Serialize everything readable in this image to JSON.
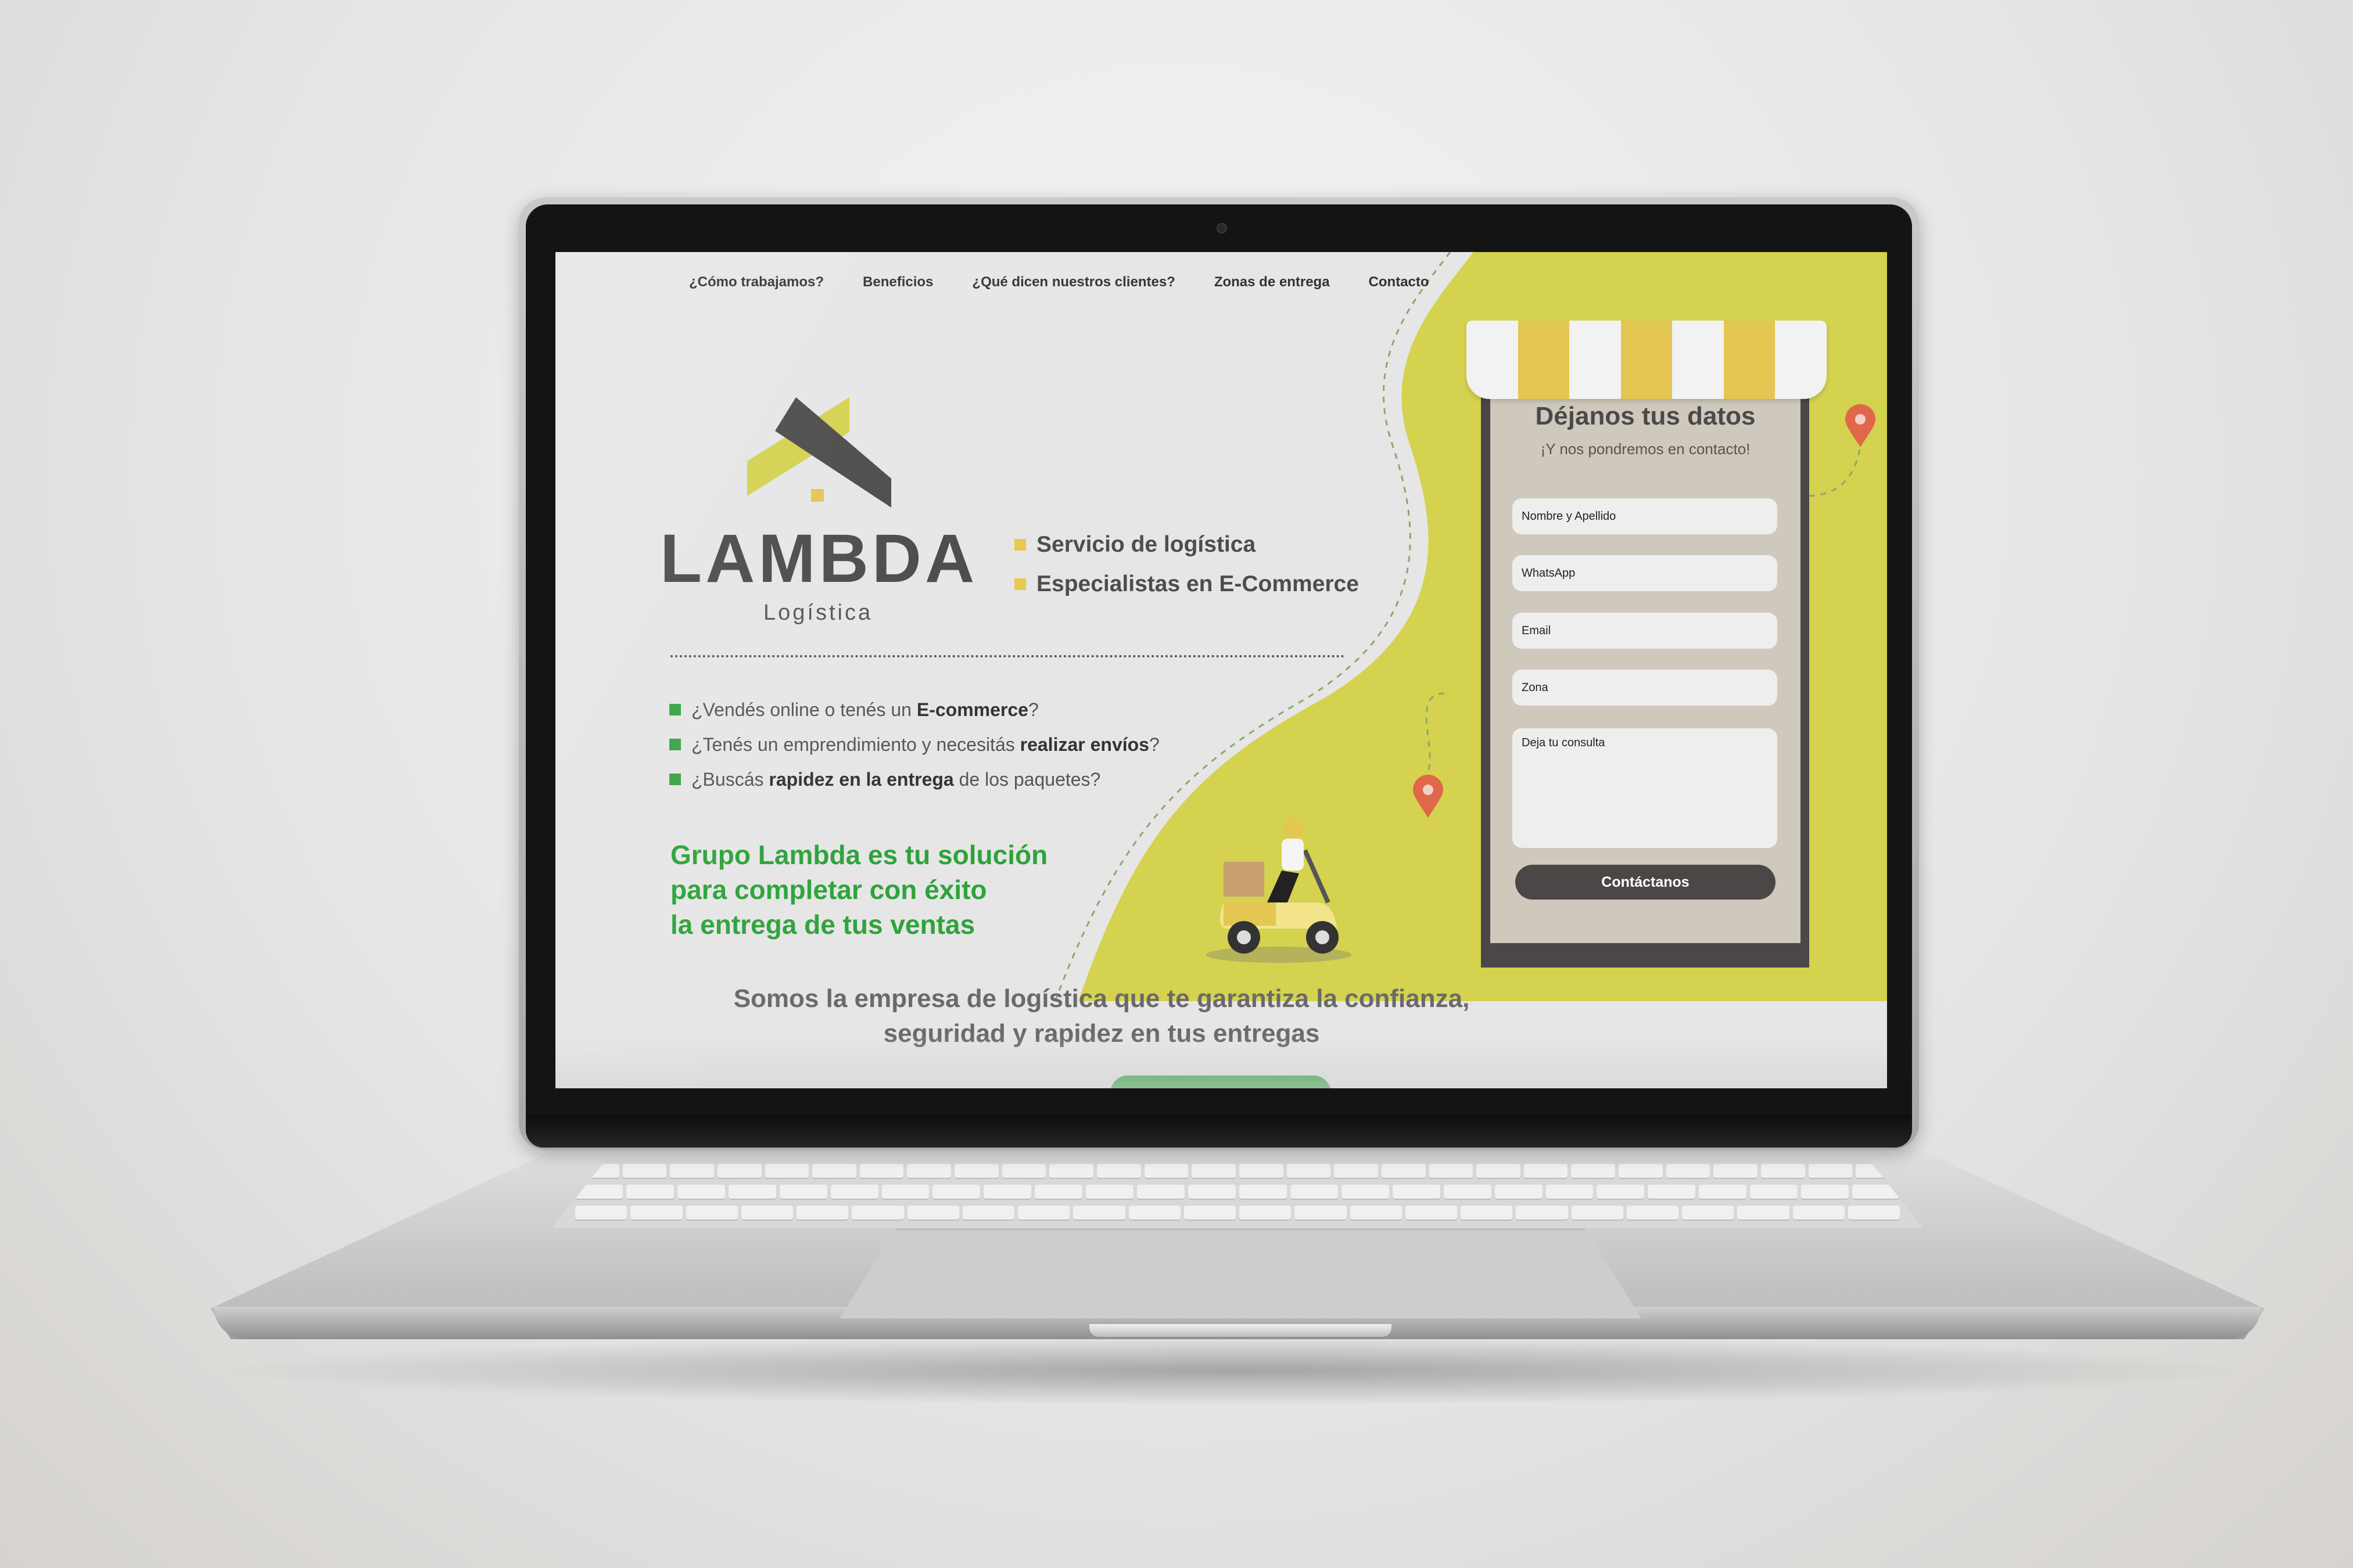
{
  "site": {
    "nav": [
      "¿Cómo trabajamos?",
      "Beneficios",
      "¿Qué dicen nuestros clientes?",
      "Zonas de entrega",
      "Contacto"
    ],
    "logo": {
      "word": "LAMBDA",
      "sub": "Logística"
    },
    "tags": [
      "Servicio de logística",
      "Especialistas en E-Commerce"
    ],
    "questions": [
      {
        "pre": "¿Vendés online o tenés un ",
        "bold": "E-commerce",
        "post": "?"
      },
      {
        "pre": "¿Tenés un emprendimiento y necesitás ",
        "bold": "realizar envíos",
        "post": "?"
      },
      {
        "pre": "¿Buscás ",
        "bold": "rapidez en la entrega",
        "post": " de los paquetes?"
      }
    ],
    "slogan": [
      "Grupo Lambda es tu solución",
      "para completar con éxito",
      "la entrega de tus ventas"
    ],
    "tagline": [
      "Somos la empresa de logística que te garantiza la confianza,",
      "seguridad y rapidez en tus entregas"
    ],
    "form": {
      "title": "Déjanos tus datos",
      "subtitle": "¡Y nos pondremos en contacto!",
      "fields": [
        "Nombre y Apellido",
        "WhatsApp",
        "Email",
        "Zona"
      ],
      "message_placeholder": "Deja tu consulta",
      "submit": "Contáctanos"
    },
    "colors": {
      "accent_yellow": "#d4d24f",
      "awning_yellow": "#e4c653",
      "green": "#2ea33a",
      "pin": "#e0674a",
      "dark": "#4a4746"
    }
  }
}
